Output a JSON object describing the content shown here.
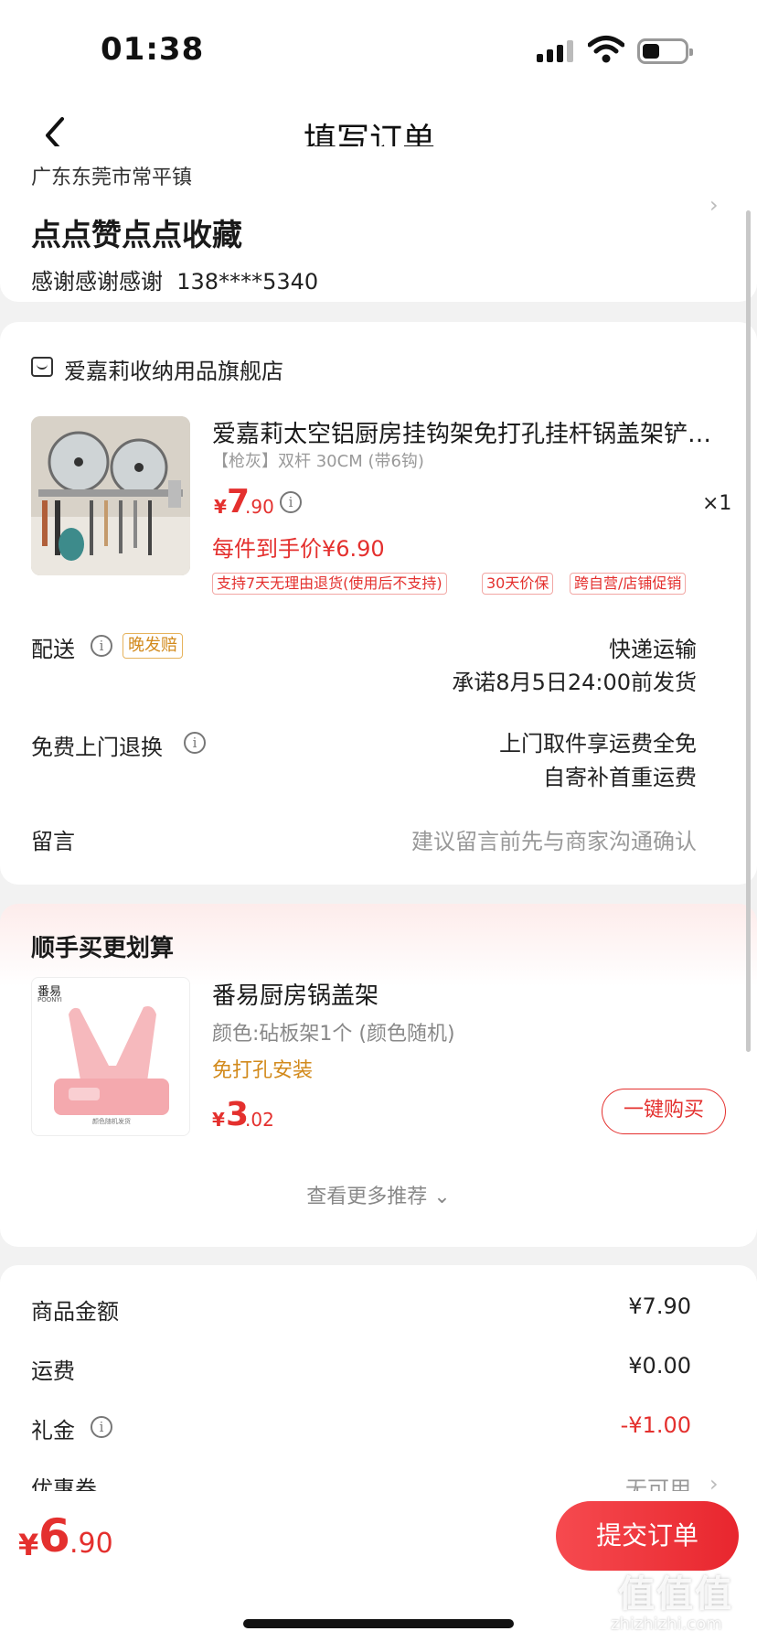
{
  "status_bar": {
    "time": "01:38"
  },
  "nav": {
    "title": "填写订单"
  },
  "address": {
    "region": "广东东莞市常平镇",
    "name": "点点赞点点收藏",
    "recipient": "感谢感谢感谢",
    "phone": "138****5340"
  },
  "shop": {
    "name": "爱嘉莉收纳用品旗舰店",
    "product": {
      "title": "爱嘉莉太空铝厨房挂钩架免打孔挂杆锅盖架铲勺…",
      "spec": "【枪灰】双杆 30CM (带6钩)",
      "price_symbol": "¥",
      "price_int": "7",
      "price_dec": ".90",
      "qty": "×1",
      "per_price": "每件到手价¥6.90",
      "tags": [
        "支持7天无理由退货(使用后不支持)",
        "30天价保",
        "跨自营/店铺促销"
      ]
    },
    "delivery": {
      "label": "配送",
      "late_tag": "晚发赔",
      "method": "快递运输",
      "promise": "承诺8月5日24:00前发货"
    },
    "returns": {
      "label": "免费上门退换",
      "line1": "上门取件享运费全免",
      "line2": "自寄补首重运费"
    },
    "message": {
      "label": "留言",
      "placeholder": "建议留言前先与商家沟通确认"
    }
  },
  "recommend": {
    "title": "顺手买更划算",
    "item": {
      "brand": "番易",
      "brand_en": "POONYI",
      "caption": "颜色随机发货",
      "name": "番易厨房锅盖架",
      "spec": "颜色:砧板架1个 (颜色随机)",
      "feature": "免打孔安装",
      "price_symbol": "¥",
      "price_int": "3",
      "price_dec": ".02",
      "buy_label": "一键购买"
    },
    "more_label": "查看更多推荐 ⌄"
  },
  "summary": {
    "goods_label": "商品金额",
    "goods_value": "¥7.90",
    "shipping_label": "运费",
    "shipping_value": "¥0.00",
    "gift_label": "礼金",
    "gift_value": "-¥1.00",
    "coupon_label": "优惠券",
    "coupon_value": "无可用"
  },
  "bottom": {
    "total_symbol": "¥",
    "total_int": "6",
    "total_dec": ".90",
    "submit_label": "提交订单"
  },
  "watermark": {
    "big": "值值值",
    "small": "zhizhizhi.com"
  },
  "colors": {
    "accent": "#e4302e",
    "orange": "#d28a1c",
    "background": "#f2f2f2"
  }
}
